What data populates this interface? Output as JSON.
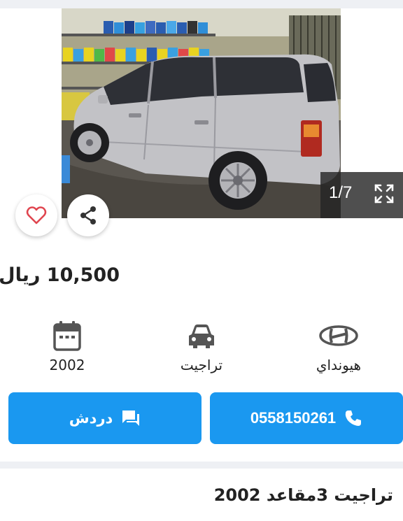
{
  "listing": {
    "price": "10,500 ريال",
    "title": "تراجيت 3مقاعد 2002"
  },
  "gallery": {
    "counter": "1/7"
  },
  "specs": {
    "year": "2002",
    "model": "تراجيت",
    "brand": "هيونداي"
  },
  "actions": {
    "chat_label": "دردش",
    "phone_label": "0558150261"
  },
  "colors": {
    "primary": "#1a98f0",
    "heart": "#e0454f",
    "icon_gray": "#555555"
  },
  "icons": [
    "chevron-left-icon",
    "chevron-right-icon",
    "fullscreen-icon",
    "heart-icon",
    "share-icon",
    "calendar-icon",
    "car-icon",
    "hyundai-logo-icon",
    "chat-icon",
    "phone-icon"
  ]
}
